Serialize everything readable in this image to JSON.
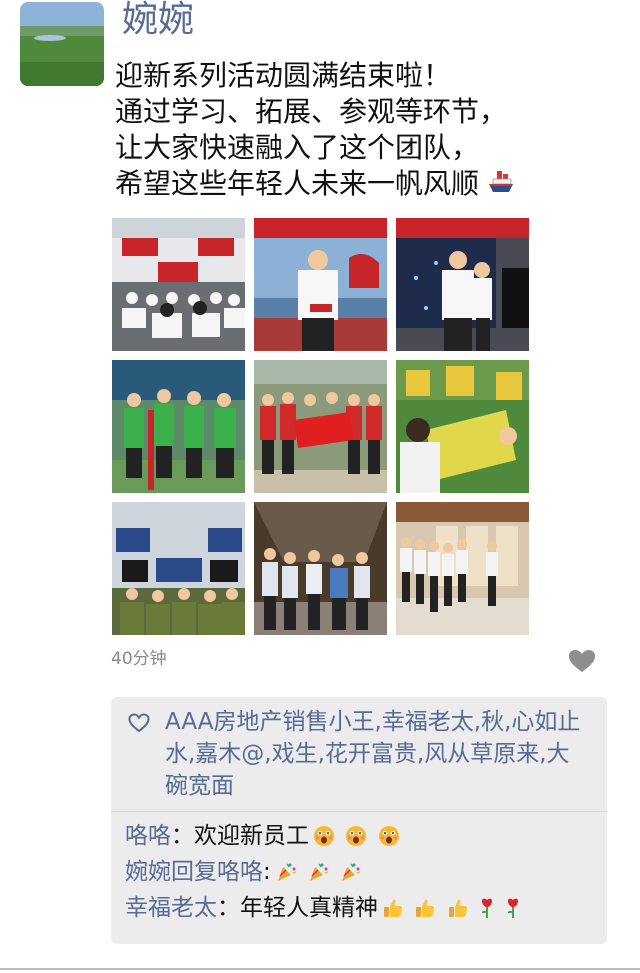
{
  "post": {
    "author": "婉婉",
    "text_lines": [
      "迎新系列活动圆满结束啦！",
      "通过学习、拓展、参观等环节，",
      "让大家快速融入了这个团队，",
      "希望这些年轻人未来一帆风顺"
    ],
    "time": "40分钟",
    "photo_count": 9
  },
  "likes": {
    "names": "AAA房地产销售小王,幸福老太,秋,心如止水,嘉木@,戏生,花开富贵,风从草原来,大碗宽面"
  },
  "comments": [
    {
      "name": "咯咯",
      "separator": "：",
      "text": "欢迎新员工",
      "emojis": [
        "face",
        "face",
        "face"
      ]
    },
    {
      "name": "婉婉回复咯咯",
      "separator": ":",
      "text": "",
      "emojis": [
        "party",
        "party",
        "party"
      ]
    },
    {
      "name": "幸福老太",
      "separator": "：",
      "text": "年轻人真精神",
      "emojis": [
        "thumb",
        "thumb",
        "thumb",
        "rose",
        "rose"
      ]
    }
  ],
  "colors": {
    "link": "#576b95",
    "comment_bg": "#ececec",
    "time": "#8a8a8a"
  },
  "icons": {
    "avatar": "landscape-avatar",
    "like": "heart-outline-icon",
    "more": "heart-more-icon",
    "post_emoji": "ship-icon"
  }
}
